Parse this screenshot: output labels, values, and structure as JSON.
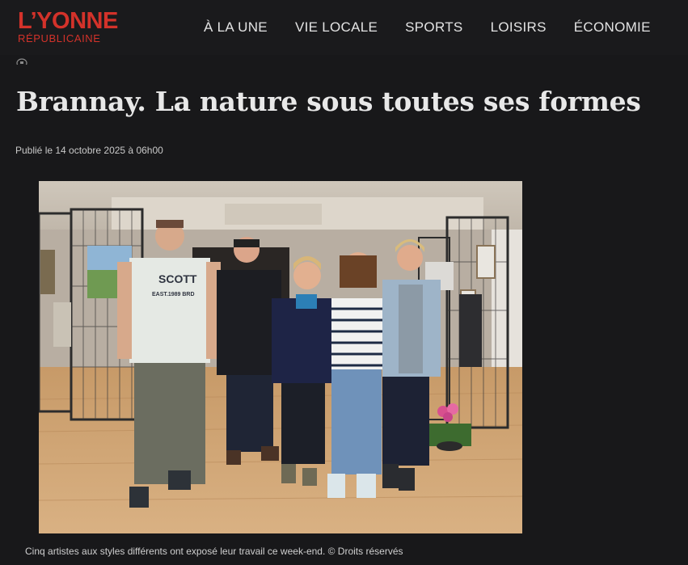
{
  "header": {
    "logo_main": "L’YONNE",
    "logo_sub": "RÉPUBLICAINE",
    "nav": [
      "À LA UNE",
      "VIE LOCALE",
      "SPORTS",
      "LOISIRS",
      "ÉCONOMIE"
    ]
  },
  "article": {
    "title": "Brannay. La nature sous toutes ses formes",
    "published": "Publié le 14 octobre 2025 à 06h00",
    "photo": {
      "shirt_text": "SCOTT",
      "shirt_subtext": "EAST.1989 BRD",
      "caption": "Cinq artistes aux styles différents ont exposé leur travail ce week-end. © Droits réservés"
    }
  },
  "colors": {
    "brand": "#d3322a",
    "background": "#18181a"
  },
  "icons": {
    "top_small": "circle-icon"
  }
}
